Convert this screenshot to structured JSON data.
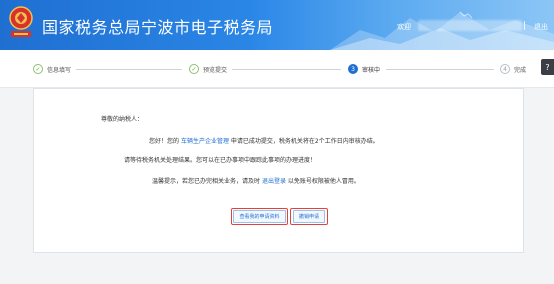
{
  "header": {
    "title": "国家税务总局宁波市电子税务局",
    "welcome": "欢迎",
    "logout": "退出"
  },
  "steps": [
    {
      "label": "信息填写",
      "state": "done",
      "mark": "✓"
    },
    {
      "label": "预览提交",
      "state": "done",
      "mark": "✓"
    },
    {
      "label": "审核中",
      "state": "active",
      "mark": "3"
    },
    {
      "label": "完成",
      "state": "todo",
      "mark": "4"
    }
  ],
  "side_button": "?",
  "notice": {
    "greeting": "尊敬的纳税人：",
    "line1_a": "您好！您的",
    "line1_item": "车辆生产企业管理",
    "line1_b": "申请已成功提交，税务机关将在2个工作日内审核办结。",
    "line2": "请等待税务机关处理结果。您可以在已办事项中跟踪此事项的办理进度！",
    "line3_a": "温馨提示，若您已办完相关业务，请及时",
    "line3_link": "退出登录",
    "line3_b": "以免账号权限被他人冒用。"
  },
  "buttons": {
    "view_docs": "查看我的申请资料",
    "withdraw": "撤销申请"
  },
  "colors": {
    "header_blue": "#1f6fd1",
    "highlight_red": "#e2423c",
    "done_green": "#6aa84f"
  }
}
